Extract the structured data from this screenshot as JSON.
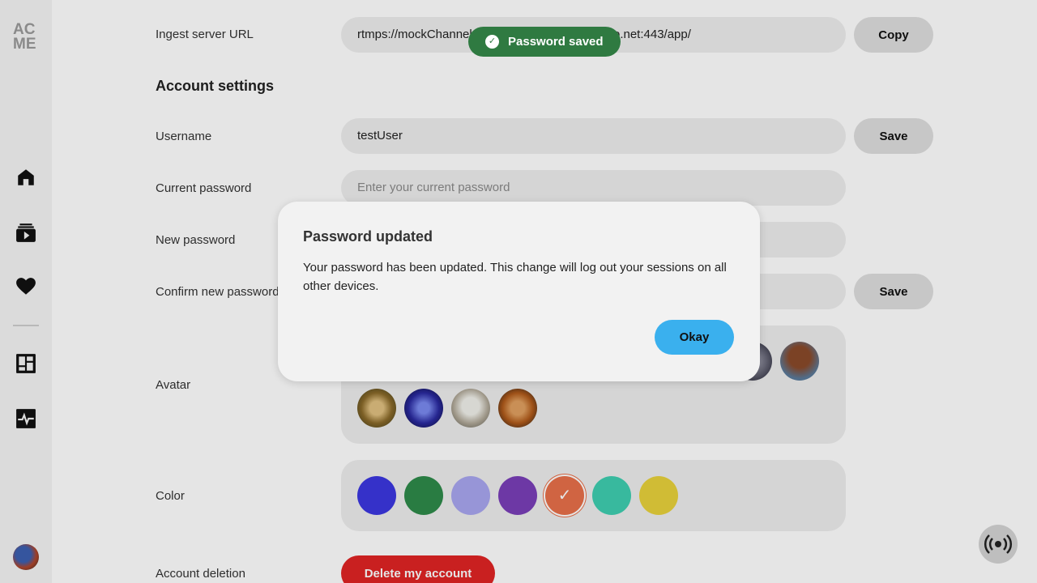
{
  "sidebar": {
    "logo_line1": "AC",
    "logo_line2": "ME",
    "items": [
      {
        "icon": "home-icon"
      },
      {
        "icon": "video-library-icon"
      },
      {
        "icon": "heart-icon"
      },
      {
        "icon": "dashboard-icon"
      },
      {
        "icon": "activity-icon"
      }
    ]
  },
  "ingest": {
    "label": "Ingest server URL",
    "value": "rtmps://mockChannel.global-contribute.live-video.net:443/app/",
    "button": "Copy"
  },
  "account": {
    "title": "Account settings",
    "username_label": "Username",
    "username_value": "testUser",
    "username_button": "Save",
    "current_password_label": "Current password",
    "current_password_placeholder": "Enter your current password",
    "new_password_label": "New password",
    "confirm_password_label": "Confirm new password",
    "password_button": "Save",
    "avatar_label": "Avatar",
    "color_label": "Color",
    "deletion_label": "Account deletion",
    "deletion_button": "Delete my account"
  },
  "colors": {
    "swatches": [
      "#3b37e0",
      "#2e8b4a",
      "#a9a6f0",
      "#7a3fb8",
      "#e8704a",
      "#3fcfb0",
      "#e8d23c"
    ],
    "selected_index": 4
  },
  "toast": {
    "text": "Password saved"
  },
  "dialog": {
    "title": "Password updated",
    "body": "Your password has been updated. This change will log out your sessions on all other devices.",
    "button": "Okay"
  }
}
